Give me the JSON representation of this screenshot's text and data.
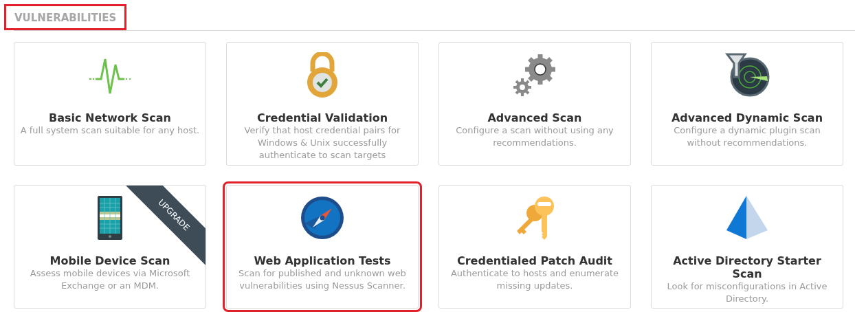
{
  "section": {
    "title": "VULNERABILITIES",
    "highlighted": true
  },
  "cards": [
    {
      "title": "Basic Network Scan",
      "description": "A full system scan suitable for any host.",
      "highlighted": false
    },
    {
      "title": "Credential Validation",
      "description": "Verify that host credential pairs for Windows & Unix successfully authenticate to scan targets",
      "highlighted": false
    },
    {
      "title": "Advanced Scan",
      "description": "Configure a scan without using any recommendations.",
      "highlighted": false
    },
    {
      "title": "Advanced Dynamic Scan",
      "description": "Configure a dynamic plugin scan without recommendations.",
      "highlighted": false
    },
    {
      "title": "Mobile Device Scan",
      "description": "Assess mobile devices via Microsoft Exchange or an MDM.",
      "ribbon": "UPGRADE",
      "highlighted": false
    },
    {
      "title": "Web Application Tests",
      "description": "Scan for published and unknown web vulnerabilities using Nessus Scanner.",
      "highlighted": true
    },
    {
      "title": "Credentialed Patch Audit",
      "description": "Authenticate to hosts and enumerate missing updates.",
      "highlighted": false
    },
    {
      "title": "Active Directory Starter Scan",
      "description": "Look for misconfigurations in Active Directory.",
      "highlighted": false
    }
  ]
}
